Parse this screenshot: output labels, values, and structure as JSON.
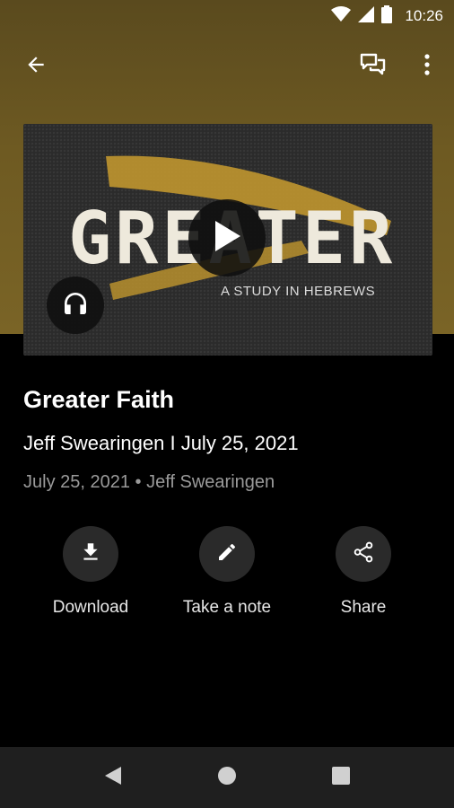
{
  "status_bar": {
    "time": "10:26",
    "icons": [
      "wifi-icon",
      "cell-signal-icon",
      "battery-icon"
    ]
  },
  "app_bar": {
    "icons": [
      "arrow-back-icon",
      "chat-icon",
      "more-vert-icon"
    ]
  },
  "artwork": {
    "title": "GREATER",
    "subtitle": "A STUDY IN HEBREWS",
    "accent_color": "#b8902e"
  },
  "media": {
    "title": "Greater Faith",
    "subtitle": "Jeff Swearingen I July 25, 2021",
    "meta": "July 25, 2021 • Jeff Swearingen"
  },
  "actions": [
    {
      "label": "Download",
      "icon": "download-icon"
    },
    {
      "label": "Take a note",
      "icon": "pencil-icon"
    },
    {
      "label": "Share",
      "icon": "share-icon"
    }
  ],
  "nav_bar": {
    "icons": [
      "nav-back-icon",
      "nav-home-icon",
      "nav-recents-icon"
    ]
  },
  "colors": {
    "hero_bg": "#6e5a22",
    "background": "#000000",
    "action_circle": "#2a2a2a",
    "nav_bar": "#1f1f1f"
  }
}
